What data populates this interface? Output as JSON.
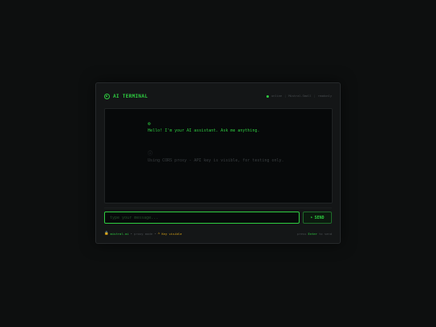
{
  "header": {
    "title": "AI TERMINAL",
    "status_online": "online",
    "status_model": "Mistral-Small",
    "status_mode": "readonly"
  },
  "messages": [
    {
      "role": "ai",
      "icon": "⚙",
      "text": "Hello! I'm your AI assistant. Ask me anything."
    },
    {
      "role": "system",
      "icon": "ⓘ",
      "text": "Using CORS proxy - API key is visible, for testing only."
    }
  ],
  "input": {
    "placeholder": "type your message...",
    "value": ""
  },
  "send": {
    "icon": "➤",
    "label": "SEND"
  },
  "footer": {
    "domain": "mistral.ai",
    "proxy_note": "• proxy mode •",
    "warning": "Key visible",
    "hint_prefix": "press",
    "hint_key": "Enter",
    "hint_suffix": "to send"
  },
  "colors": {
    "accent": "#2ecc40",
    "warning": "#d4a017",
    "background": "#0d0f0f"
  }
}
